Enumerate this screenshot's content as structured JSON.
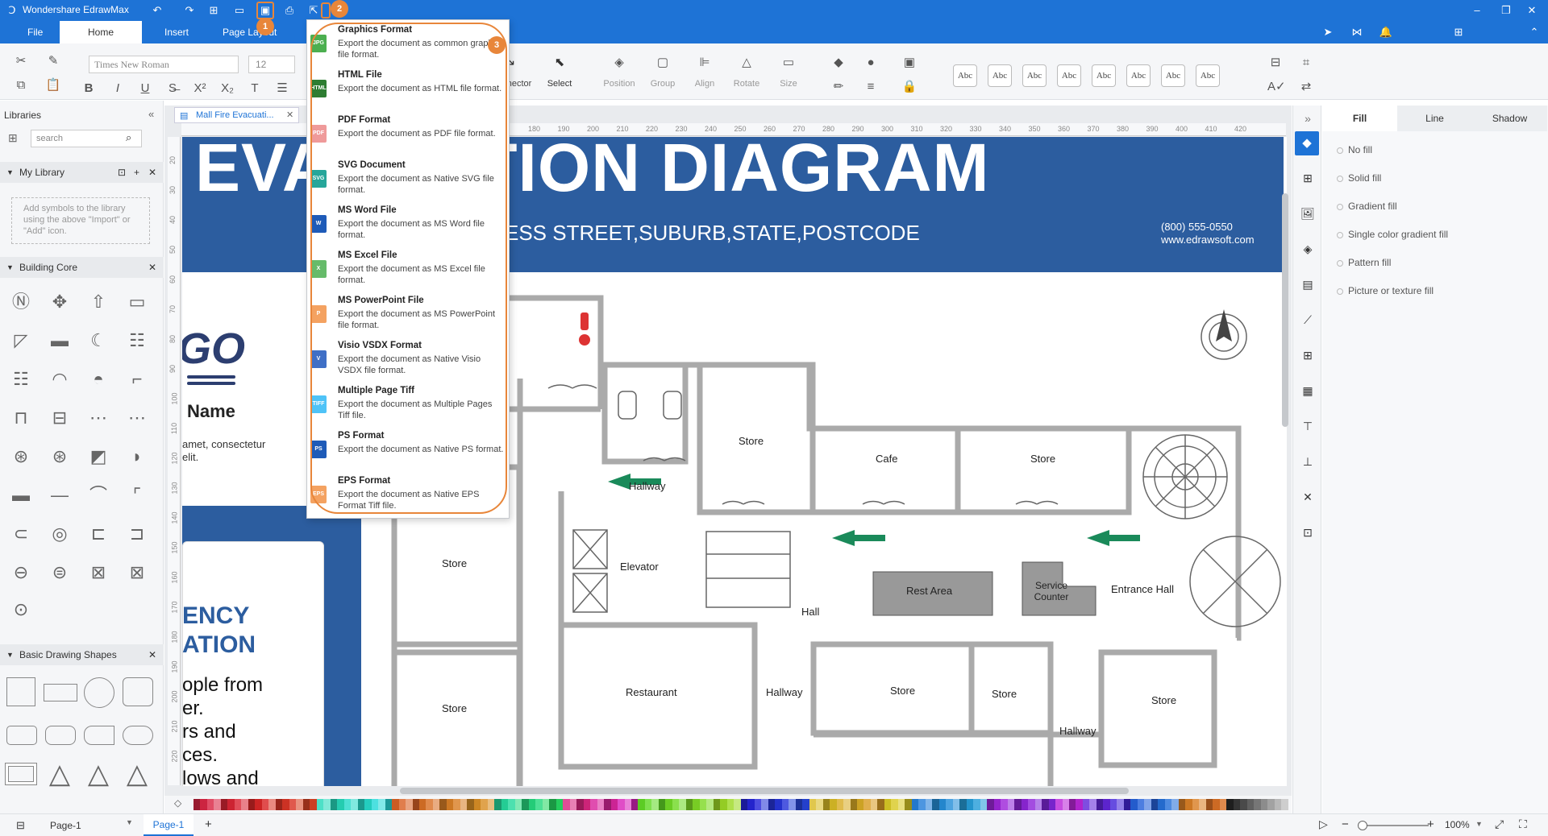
{
  "app": {
    "title": "Wondershare EdrawMax"
  },
  "menus": [
    "File",
    "Home",
    "Insert",
    "Page Layout"
  ],
  "ribbon": {
    "font_family": "Times New Roman",
    "font_size": "12",
    "connector_label": "nector",
    "select_label": "Select",
    "position_label": "Position",
    "group_label": "Group",
    "align_label": "Align",
    "rotate_label": "Rotate",
    "size_label": "Size",
    "style_preset": "Abc"
  },
  "library": {
    "title": "Libraries",
    "search_placeholder": "search",
    "my_library": "My Library",
    "my_library_hint": "Add symbols to the library using the above \"Import\" or \"Add\" icon.",
    "building_core": "Building Core",
    "basic_shapes": "Basic Drawing Shapes"
  },
  "document": {
    "tab_name": "Mall Fire Evacuati...",
    "banner_title": "EVACUATION DIAGRAM",
    "banner_address": "ESS STREET,SUBURB,STATE,POSTCODE",
    "phone": "(800) 555-0550",
    "website": "www.edrawsoft.com",
    "logo": "GO",
    "name_label": "Name",
    "lorem": "amet, consectetur elit.",
    "emergency_1": "ENCY",
    "emergency_2": "ATION",
    "bullets": [
      "ople from",
      "er.",
      "rs and",
      "ces.",
      "lows and"
    ],
    "rooms": [
      "Store",
      "Cafe",
      "Store",
      "Hallway",
      "Elevator",
      "Rest Area",
      "Service Counter",
      "Entrance Hall",
      "Hall",
      "Store",
      "Restaurant",
      "Hallway",
      "Store",
      "Store",
      "Store",
      "Store",
      "Hallway"
    ],
    "ruler_h": [
      "180",
      "190",
      "200",
      "210",
      "220",
      "230",
      "240",
      "250",
      "260",
      "270",
      "280",
      "290",
      "300",
      "310",
      "320",
      "330",
      "340",
      "350",
      "360",
      "370",
      "380",
      "390",
      "400",
      "410",
      "420"
    ],
    "ruler_v": [
      "20",
      "30",
      "40",
      "50",
      "60",
      "70",
      "80",
      "90",
      "100",
      "110",
      "120",
      "130",
      "140",
      "150",
      "160",
      "170",
      "180",
      "190",
      "200",
      "210",
      "220"
    ]
  },
  "export_menu": {
    "items": [
      {
        "title": "Graphics Format",
        "desc": "Export the document as common graphic file format.",
        "icon": "image-icon",
        "color": "#4caf50",
        "abbr": "JPG"
      },
      {
        "title": "HTML File",
        "desc": "Export the document as HTML file format.",
        "icon": "html-icon",
        "color": "#2e7d32",
        "abbr": "HTML"
      },
      {
        "title": "PDF Format",
        "desc": "Export the document as PDF file format.",
        "icon": "pdf-icon",
        "color": "#ef9a9a",
        "abbr": "PDF"
      },
      {
        "title": "SVG Document",
        "desc": "Export the document as Native SVG file format.",
        "icon": "svg-icon",
        "color": "#26a69a",
        "abbr": "SVG"
      },
      {
        "title": "MS Word File",
        "desc": "Export the document as MS Word file format.",
        "icon": "word-icon",
        "color": "#1e5bb8",
        "abbr": "W"
      },
      {
        "title": "MS Excel File",
        "desc": "Export the document as MS Excel file format.",
        "icon": "excel-icon",
        "color": "#66bb6a",
        "abbr": "X"
      },
      {
        "title": "MS PowerPoint File",
        "desc": "Export the document as MS PowerPoint file format.",
        "icon": "powerpoint-icon",
        "color": "#f4a261",
        "abbr": "P"
      },
      {
        "title": "Visio VSDX Format",
        "desc": "Export the document as Native Visio VSDX file format.",
        "icon": "visio-icon",
        "color": "#3f6fc6",
        "abbr": "V"
      },
      {
        "title": "Multiple Page Tiff",
        "desc": "Export the document as Multiple Pages Tiff file.",
        "icon": "tiff-icon",
        "color": "#4fc3f7",
        "abbr": "TIFF"
      },
      {
        "title": "PS Format",
        "desc": "Export the document as Native PS format.",
        "icon": "ps-icon",
        "color": "#1e5bb8",
        "abbr": "PS"
      },
      {
        "title": "EPS Format",
        "desc": "Export the document as Native EPS Format Tiff file.",
        "icon": "eps-icon",
        "color": "#f4a261",
        "abbr": "EPS"
      }
    ]
  },
  "badges": [
    "1",
    "2",
    "3"
  ],
  "right_panel": {
    "tabs": [
      "Fill",
      "Line",
      "Shadow"
    ],
    "options": [
      "No fill",
      "Solid fill",
      "Gradient fill",
      "Single color gradient fill",
      "Pattern fill",
      "Picture or texture fill"
    ]
  },
  "status": {
    "page_selector": "Page-1",
    "page_tab": "Page-1",
    "zoom": "100%"
  },
  "colors": {
    "accent": "#1e73d6",
    "banner": "#2c5d9f",
    "highlight": "#e8863a",
    "arrow": "#1a8a5a"
  }
}
